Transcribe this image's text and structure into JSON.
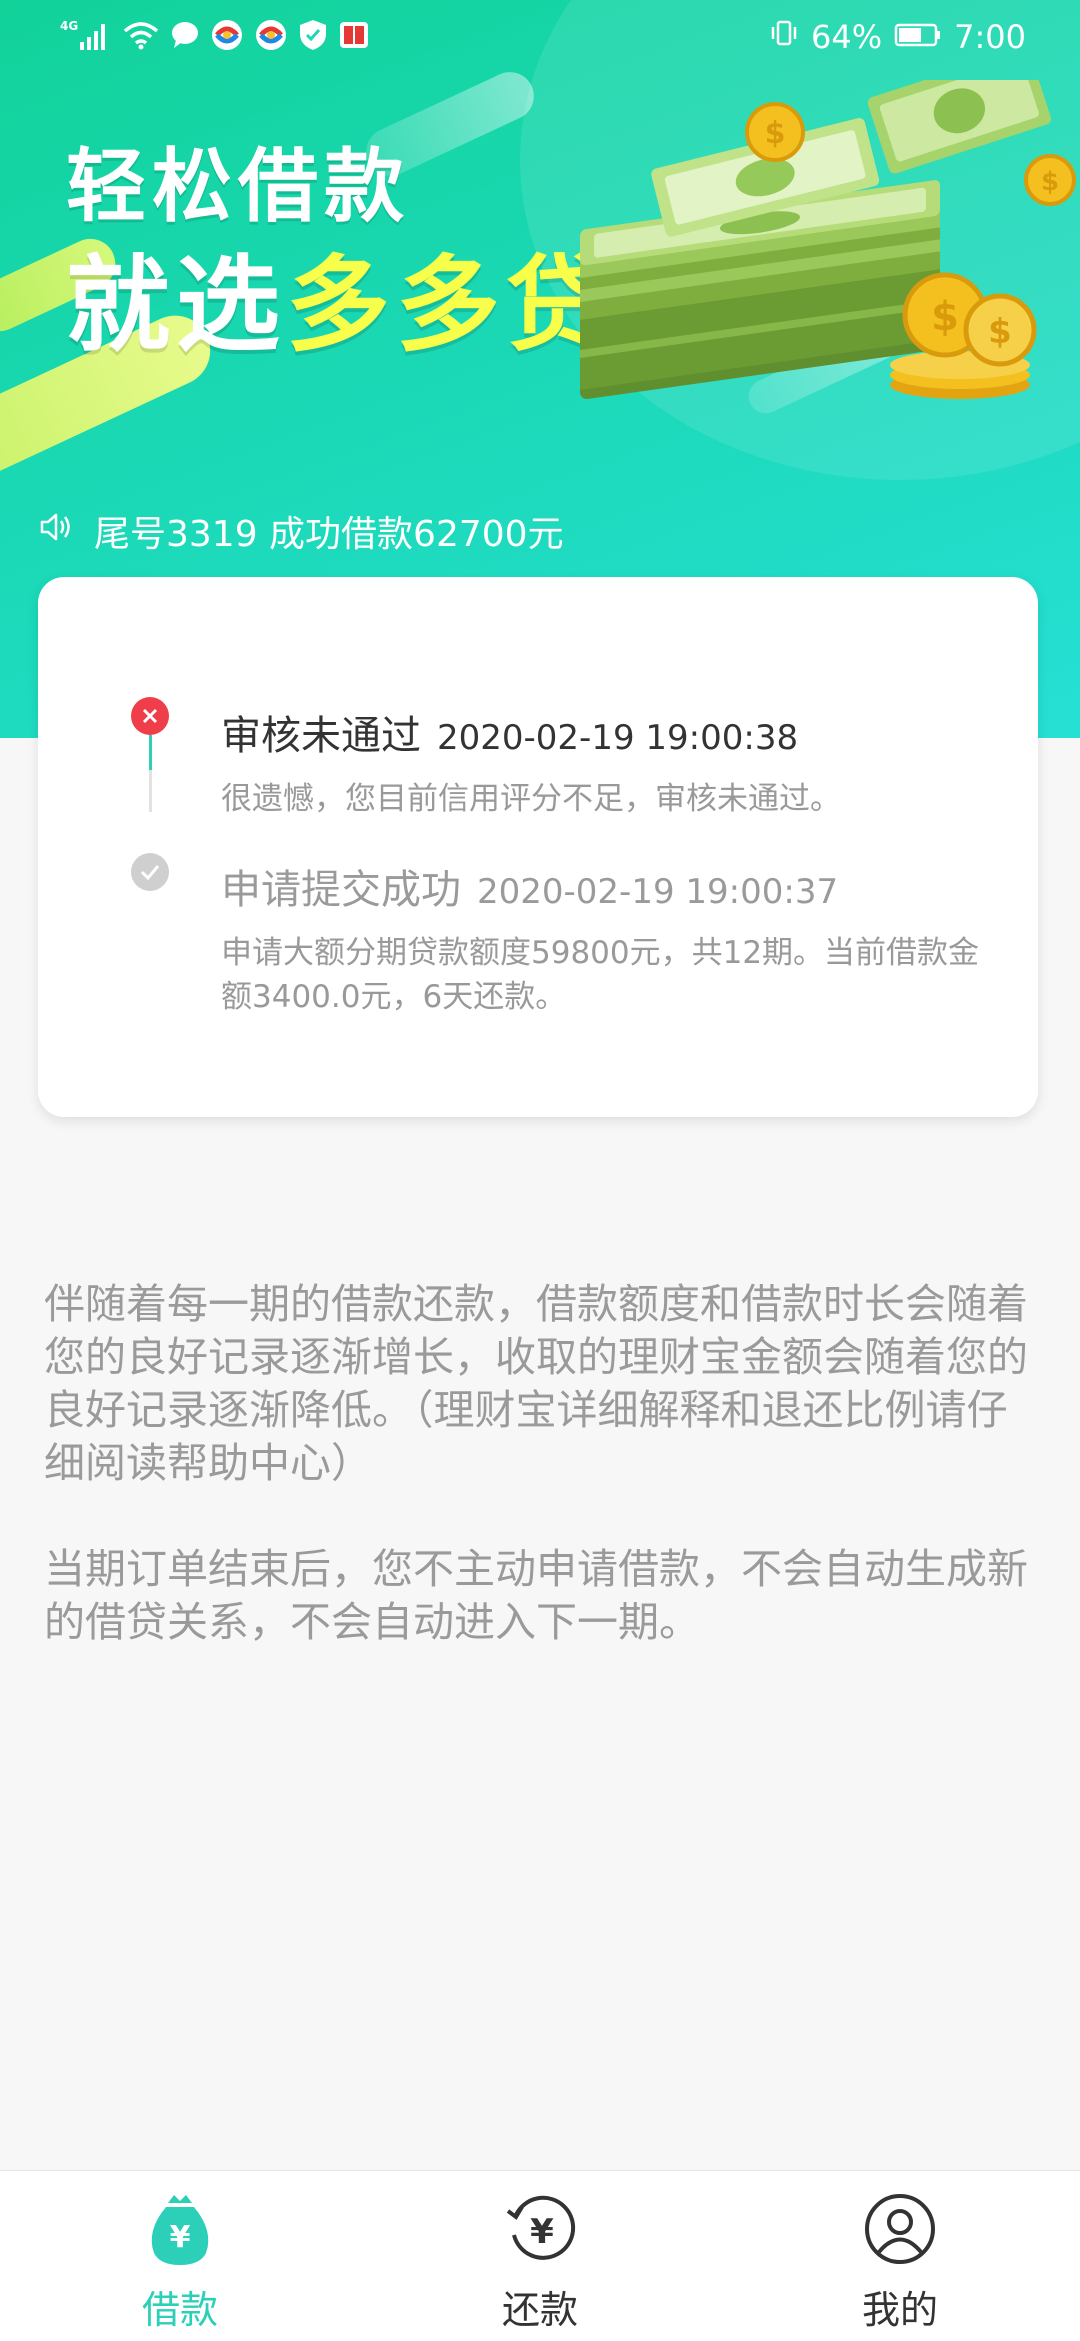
{
  "status_bar": {
    "network": "4G",
    "battery": "64%",
    "time": "7:00"
  },
  "hero": {
    "title_line1": "轻松借款",
    "title_line2_prefix": "就选",
    "title_line2_highlight": "多多贷"
  },
  "notice": {
    "text": "尾号3319 成功借款62700元"
  },
  "timeline": [
    {
      "title": "审核未通过",
      "date": "2020-02-19 19:00:38",
      "desc": "很遗憾，您目前信用评分不足，审核未通过。",
      "status": "rejected"
    },
    {
      "title": "申请提交成功",
      "date": "2020-02-19 19:00:37",
      "desc": "申请大额分期贷款额度59800元，共12期。当前借款金额3400.0元，6天还款。",
      "status": "done"
    }
  ],
  "info": {
    "paragraph1": "伴随着每一期的借款还款，借款额度和借款时长会随着您的良好记录逐渐增长，收取的理财宝金额会随着您的良好记录逐渐降低。（理财宝详细解释和退还比例请仔细阅读帮助中心）",
    "paragraph2": "当期订单结束后，您不主动申请借款，不会自动生成新的借贷关系，不会自动进入下一期。"
  },
  "bottom_nav": {
    "items": [
      {
        "label": "借款",
        "icon": "money-bag-icon",
        "active": true
      },
      {
        "label": "还款",
        "icon": "repay-icon",
        "active": false
      },
      {
        "label": "我的",
        "icon": "profile-icon",
        "active": false
      }
    ]
  },
  "colors": {
    "accent": "#2cd0b8",
    "hero_start": "#12d29a",
    "hero_end": "#26e0d5",
    "highlight": "#f7ff4a",
    "reject": "#ef3e4a"
  }
}
